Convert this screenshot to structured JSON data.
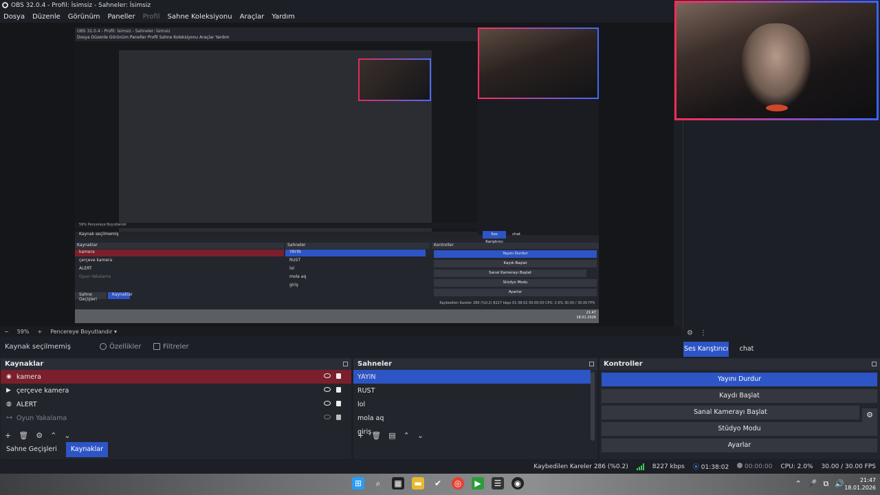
{
  "window": {
    "title": "OBS 32.0.4 - Profil: İsimsiz - Sahneler: İsimsiz"
  },
  "menu": [
    "Dosya",
    "Düzenle",
    "Görünüm",
    "Paneller",
    "Profil",
    "Sahne Koleksiyonu",
    "Araçlar",
    "Yardım"
  ],
  "menu_disabled": "Profil",
  "zoom": {
    "minus": "−",
    "value": "59%",
    "plus": "+",
    "fit": "Pencereye Boyutlandır"
  },
  "source_toolbar": {
    "none_selected": "Kaynak seçilmemiş",
    "properties": "Özellikler",
    "filters": "Filtreler"
  },
  "mixer_tabs": {
    "active": "Ses Karıştırıcı",
    "other": "chat"
  },
  "sources": {
    "title": "Kaynaklar",
    "items": [
      {
        "label": "kamera",
        "icon": "camera-icon"
      },
      {
        "label": "çerçeve kamera",
        "icon": "play-icon"
      },
      {
        "label": "ALERT",
        "icon": "globe-icon"
      },
      {
        "label": "Oyun Yakalama",
        "icon": "gamepad-icon"
      }
    ],
    "tabs": {
      "transitions": "Sahne Geçişleri",
      "sources": "Kaynaklar"
    }
  },
  "scenes": {
    "title": "Sahneler",
    "items": [
      "YAYIN",
      "RUST",
      "lol",
      "mola aq",
      "giriş"
    ]
  },
  "controls": {
    "title": "Kontroller",
    "stop_stream": "Yayını Durdur",
    "start_record": "Kaydı Başlat",
    "virtual_cam": "Sanal Kamerayı Başlat",
    "studio_mode": "Stüdyo Modu",
    "settings": "Ayarlar"
  },
  "status": {
    "dropped": "Kaybedilen Kareler 286 (%0.2)",
    "bitrate": "8227 kbps",
    "stream_time": "01:38:02",
    "record_time": "00:00:00",
    "cpu": "CPU: 2.0%",
    "fps": "30.00 / 30.00 FPS"
  },
  "clock": {
    "time": "21:47",
    "date": "18.01.2026"
  },
  "nested": {
    "title": "OBS 32.0.4 - Profil: İsimsiz - Sahneler: İsimsiz",
    "menu": "Dosya   Düzenle   Görünüm   Paneller   Profil   Sahne Koleksiyonu   Araçlar   Yardım",
    "zoom": "59%   Pencereye Boyutlandır",
    "src_none": "Kaynak seçilmemiş",
    "kaynaklar": "Kaynaklar",
    "sahneler": "Sahneler",
    "kontroller": "Kontroller",
    "src_items": [
      "kamera",
      "çerçeve kamera",
      "ALERT",
      "Oyun Yakalama"
    ],
    "scene_items": [
      "YAYIN",
      "RUST",
      "lol",
      "mola aq",
      "giriş"
    ],
    "ctrl_items": [
      "Yayını Durdur",
      "Kaydı Başlat",
      "Sanal Kamerayı Başlat",
      "Stüdyo Modu",
      "Ayarlar"
    ],
    "tab_a": "Sahne Geçişleri",
    "tab_b": "Kaynaklar",
    "mixer": "Ses Karıştırıcı",
    "chat": "chat",
    "status": "Kaybedilen Kareler 286 (%0.2)   8227 kbps   01:38:02   00:00:00   CPU: 2.6%   30.00 / 30.00 FPS",
    "clock_time": "21:47",
    "clock_date": "18.01.2026"
  },
  "colors": {
    "accent": "#2d55c6",
    "selected_source": "#7a1f2b",
    "camera_border_a": "#ff2d55",
    "camera_border_b": "#3b63ff"
  }
}
